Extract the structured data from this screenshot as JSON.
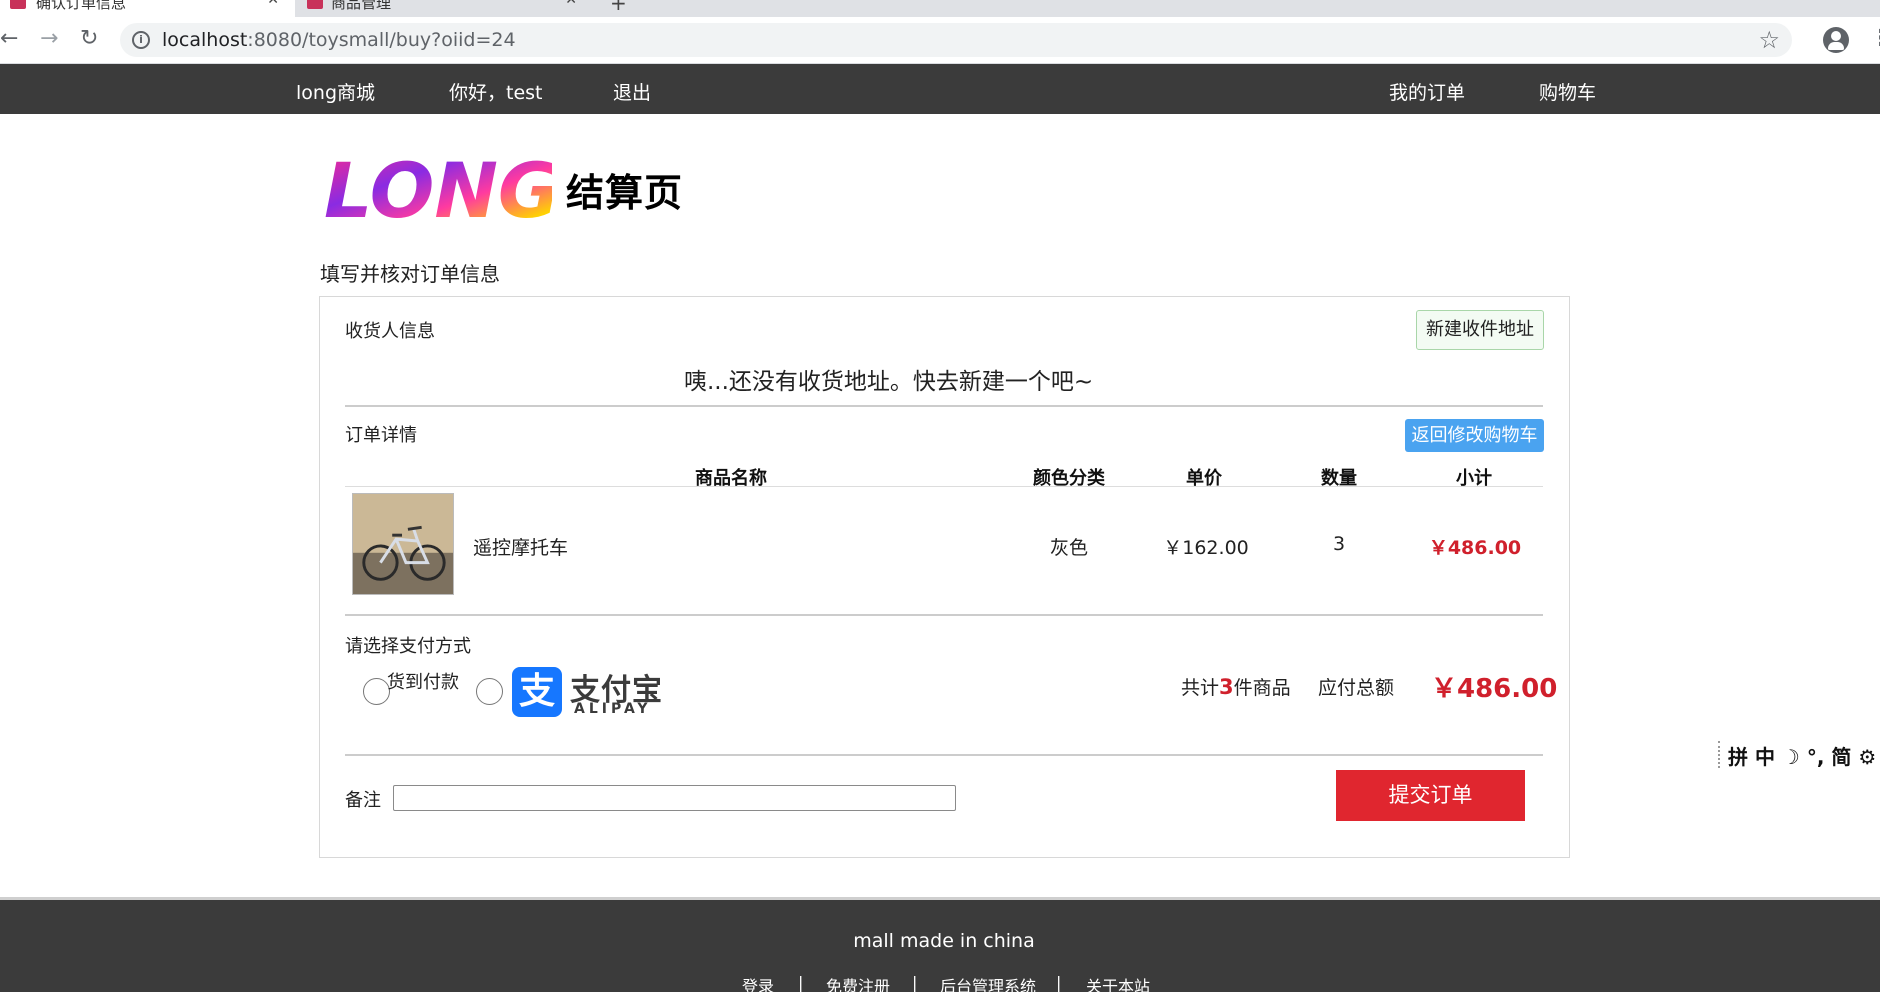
{
  "browser": {
    "tabs": [
      {
        "title": "确认订单信息",
        "close": "✕"
      },
      {
        "title": "商品管理",
        "close": "✕"
      }
    ],
    "new_tab": "+",
    "url_host": "localhost",
    "url_rest": ":8080/toysmall/buy?oiid=24"
  },
  "nav": {
    "brand": "long商城",
    "greeting": "你好，test",
    "logout": "退出",
    "my_orders": "我的订单",
    "cart": "购物车"
  },
  "header": {
    "logo_text": "LONG",
    "title": "结算页",
    "prompt": "填写并核对订单信息"
  },
  "consignee": {
    "label": "收货人信息",
    "new_address_button": "新建收件地址",
    "empty_message": "咦...还没有收货地址。快去新建一个吧~"
  },
  "order": {
    "label": "订单详情",
    "back_button": "返回修改购物车",
    "columns": [
      "商品名称",
      "颜色分类",
      "单价",
      "数量",
      "小计"
    ],
    "items": [
      {
        "name": "遥控摩托车",
        "color": "灰色",
        "price": "￥162.00",
        "qty": "3",
        "subtotal": "￥486.00"
      }
    ]
  },
  "payment": {
    "label": "请选择支付方式",
    "cod_label": "货到付款",
    "alipay_cn": "支付宝",
    "alipay_en": "ALIPAY",
    "count_prefix": "共计",
    "count": "3",
    "count_suffix": "件商品",
    "total_label": "应付总额",
    "total_amount": "￥486.00"
  },
  "remark": {
    "label": "备注",
    "value": ""
  },
  "submit_button": "提交订单",
  "ime": "拼 中 ☽ °, 简 ⚙",
  "footer": {
    "slogan": "mall made in china",
    "links": [
      "登录",
      "免费注册",
      "后台管理系统",
      "关于本站"
    ],
    "separator": "|"
  },
  "colors": {
    "nav_bg": "#3b3b3b",
    "accent_red": "#d0202c",
    "submit_red": "#e0262f",
    "back_button_blue": "#4aa3f0",
    "alipay_blue": "#1677ff"
  }
}
